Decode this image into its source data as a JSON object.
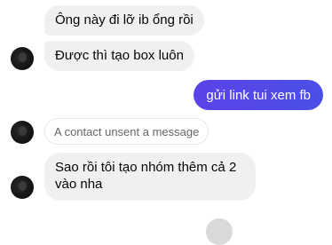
{
  "messages": {
    "m1": "Ông này đi lỡ ib ổng rồi",
    "m2": "Được thì tạo box luôn",
    "m3": "gửi link tui xem fb",
    "m4": "A contact unsent a message",
    "m5_line1": "Sao rồi tôi tạo nhóm thêm cả 2",
    "m5_line2": "vào nha"
  },
  "colors": {
    "incoming_bubble": "#f0f0f0",
    "outgoing_bubble": "#5a43e8",
    "unsent_text": "#65676b"
  }
}
